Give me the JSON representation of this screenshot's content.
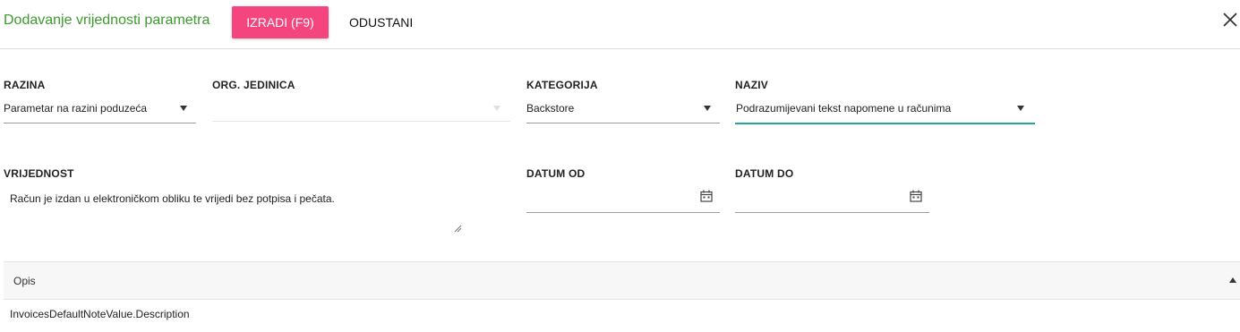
{
  "header": {
    "title": "Dodavanje vrijednosti parametra",
    "create_label": "IZRADI (F9)",
    "cancel_label": "ODUSTANI"
  },
  "form": {
    "razina": {
      "label": "RAZINA",
      "value": "Parametar na razini poduzeća"
    },
    "org_jedinica": {
      "label": "ORG. JEDINICA",
      "value": ""
    },
    "kategorija": {
      "label": "KATEGORIJA",
      "value": "Backstore"
    },
    "naziv": {
      "label": "NAZIV",
      "value": "Podrazumijevani tekst napomene u računima"
    },
    "vrijednost": {
      "label": "VRIJEDNOST",
      "value": "Račun je izdan u elektroničkom obliku te vrijedi bez potpisa i pečata."
    },
    "datum_od": {
      "label": "DATUM OD",
      "value": ""
    },
    "datum_do": {
      "label": "DATUM DO",
      "value": ""
    }
  },
  "opis": {
    "label": "Opis",
    "text": "InvoicesDefaultNoteValue.Description"
  },
  "colors": {
    "accent": "#f4457f",
    "title": "#3c9a2c",
    "focus": "#26a69a"
  },
  "icons": [
    "close-icon",
    "dropdown-caret-icon",
    "calendar-icon",
    "resize-handle-icon",
    "collapse-caret-icon"
  ]
}
